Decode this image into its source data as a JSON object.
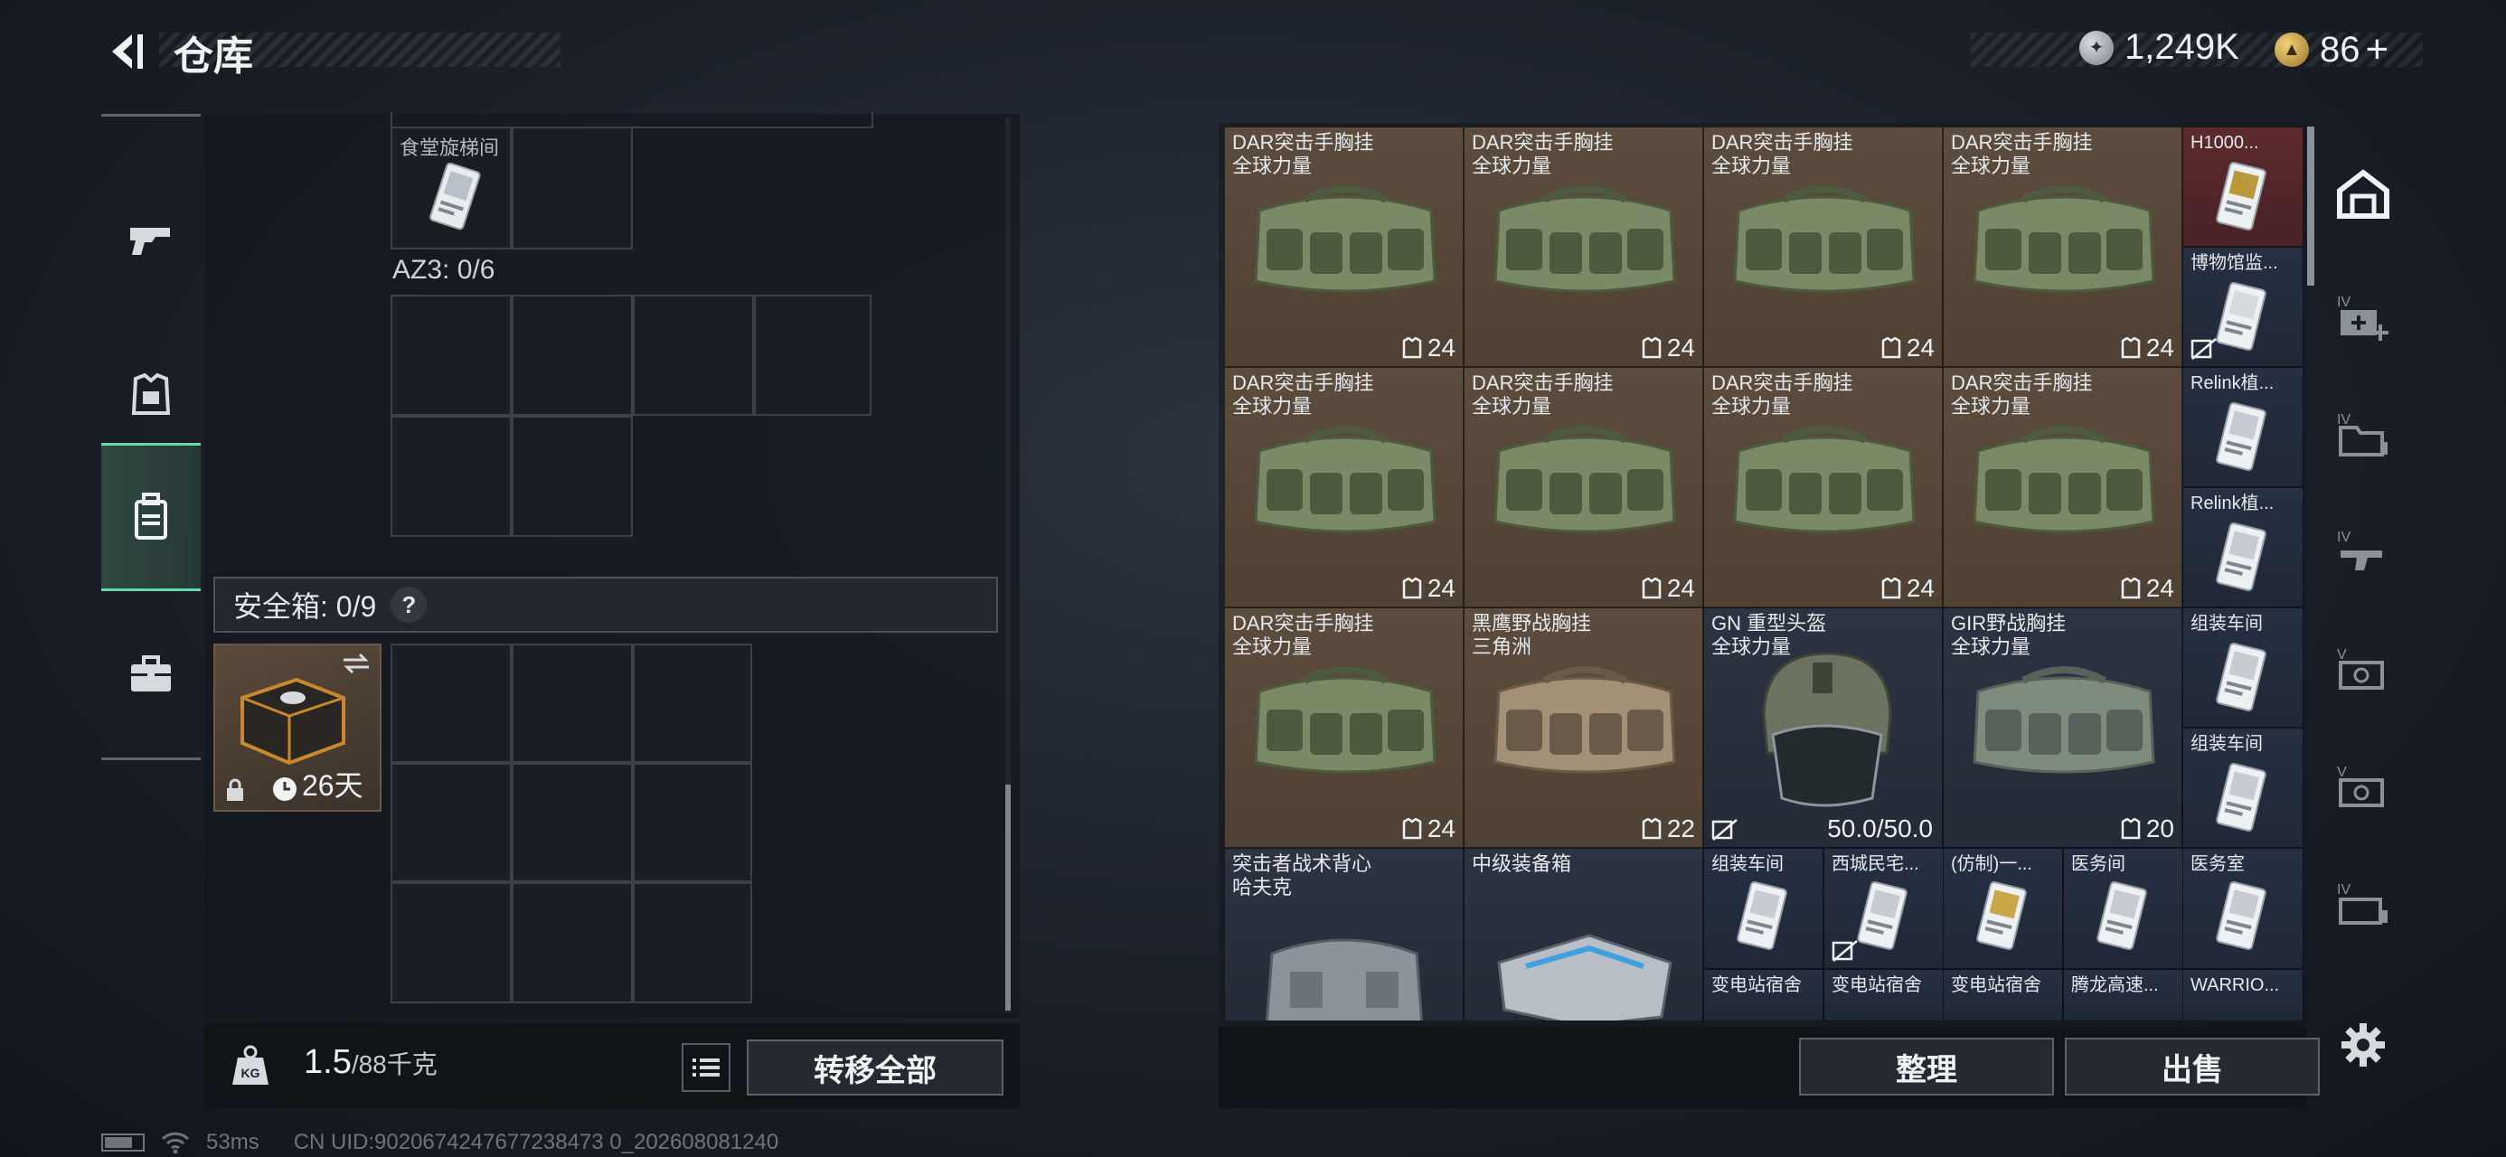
{
  "header": {
    "title": "仓库",
    "silver_amount": "1,249K",
    "gold_amount": "86",
    "gold_plus": "+",
    "accent_color": "#67d7a6"
  },
  "left_rail": [
    "gun-icon",
    "armor-icon",
    "backpack-icon",
    "briefcase-icon"
  ],
  "left_panel": {
    "cell_label": "食堂旋梯间",
    "az3_label": "AZ3: 0/6",
    "safe_label": "安全箱: 0/9",
    "safe_help": "?",
    "safe_item_timer": "26天"
  },
  "weight": {
    "current": "1.5",
    "max": "/88千克",
    "transfer_all": "转移全部",
    "kg_icon_text": "KG"
  },
  "grid_items": [
    {
      "line1": "DAR突击手胸挂",
      "line2": "全球力量",
      "count": "24"
    },
    {
      "line1": "DAR突击手胸挂",
      "line2": "全球力量",
      "count": "24"
    },
    {
      "line1": "DAR突击手胸挂",
      "line2": "全球力量",
      "count": "24"
    },
    {
      "line1": "DAR突击手胸挂",
      "line2": "全球力量",
      "count": "24"
    },
    {
      "line1": "DAR突击手胸挂",
      "line2": "全球力量",
      "count": "24"
    },
    {
      "line1": "DAR突击手胸挂",
      "line2": "全球力量",
      "count": "24"
    },
    {
      "line1": "DAR突击手胸挂",
      "line2": "全球力量",
      "count": "24"
    },
    {
      "line1": "DAR突击手胸挂",
      "line2": "全球力量",
      "count": "24"
    },
    {
      "line1": "DAR突击手胸挂",
      "line2": "全球力量",
      "count": "24"
    },
    {
      "line1": "黑鹰野战胸挂",
      "line2": "三角洲",
      "count": "22"
    },
    {
      "line1": "GN 重型头盔",
      "line2": "全球力量",
      "durability": "50.0/50.0"
    },
    {
      "line1": "GIR野战胸挂",
      "line2": "全球力量",
      "count": "20"
    },
    {
      "line1": "突击者战术背心",
      "line2": "哈夫克"
    },
    {
      "line1": "中级装备箱",
      "line2": ""
    }
  ],
  "side_column": [
    "H1000...",
    "博物馆监...",
    "Relink植...",
    "Relink植...",
    "组装车间",
    "组装车间"
  ],
  "small_cards": [
    "组装车间",
    "西城民宅...",
    "(仿制)一...",
    "医务间",
    "医务室"
  ],
  "small_cards_row2": [
    "变电站宿舍",
    "变电站宿舍",
    "变电站宿舍",
    "腾龙高速...",
    "WARRIO..."
  ],
  "actions": {
    "sort": "整理",
    "sell": "出售"
  },
  "status_bar": {
    "ping": "53ms",
    "uid": "CN UID:9020674247677238473 0_202608081240"
  }
}
